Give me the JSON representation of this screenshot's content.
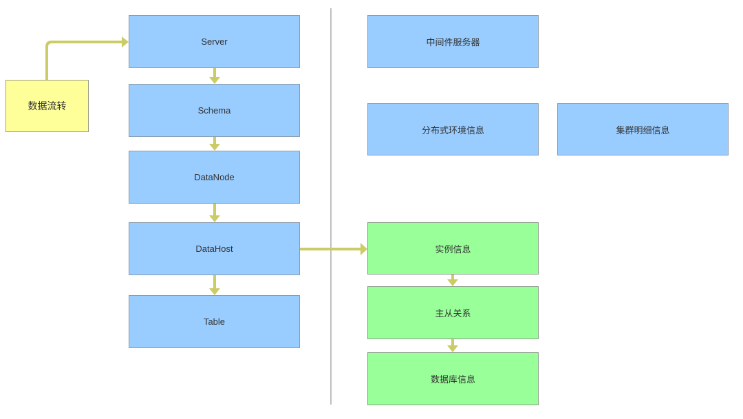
{
  "diagram": {
    "colors": {
      "primary_node": "#99ccff",
      "secondary_node": "#99ff99",
      "legend_node": "#ffff99",
      "connector": "#cccc66",
      "divider": "#aaaaaa"
    },
    "legend": {
      "label": "数据流转"
    },
    "left_column": [
      {
        "id": "server",
        "label": "Server"
      },
      {
        "id": "schema",
        "label": "Schema"
      },
      {
        "id": "datanode",
        "label": "DataNode"
      },
      {
        "id": "datahost",
        "label": "DataHost"
      },
      {
        "id": "table",
        "label": "Table"
      }
    ],
    "right_top": [
      {
        "id": "middleware",
        "label": "中间件服务器"
      },
      {
        "id": "distributed-env",
        "label": "分布式环境信息"
      },
      {
        "id": "cluster-detail",
        "label": "集群明细信息"
      }
    ],
    "right_flow": [
      {
        "id": "instance",
        "label": "实例信息"
      },
      {
        "id": "master-slave",
        "label": "主从关系"
      },
      {
        "id": "database",
        "label": "数据库信息"
      }
    ],
    "edges": [
      {
        "from": "legend",
        "to": "server"
      },
      {
        "from": "server",
        "to": "schema"
      },
      {
        "from": "schema",
        "to": "datanode"
      },
      {
        "from": "datanode",
        "to": "datahost"
      },
      {
        "from": "datahost",
        "to": "table"
      },
      {
        "from": "datahost",
        "to": "instance"
      },
      {
        "from": "instance",
        "to": "master-slave"
      },
      {
        "from": "master-slave",
        "to": "database"
      }
    ]
  }
}
